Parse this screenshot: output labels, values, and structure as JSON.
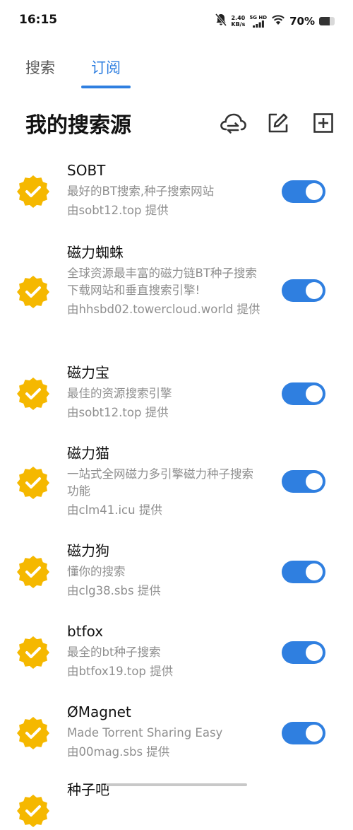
{
  "status_bar": {
    "time": "16:15",
    "net_speed_value": "2.40",
    "net_speed_unit": "KB/s",
    "signal_label": "5G HD",
    "battery_percent": "70%",
    "battery_level": 0.7
  },
  "tabs": [
    {
      "label": "搜索",
      "selected": false
    },
    {
      "label": "订阅",
      "selected": true
    }
  ],
  "section": {
    "title": "我的搜索源"
  },
  "icons": {
    "cloud_sync": "cloud-sync-icon",
    "edit": "edit-icon",
    "add": "add-icon",
    "badge": "verified-badge-icon"
  },
  "colors": {
    "accent": "#2f7fe0",
    "badge": "#f5b800",
    "secondary_text": "#8f8f8f"
  },
  "sources": [
    {
      "name": "SOBT",
      "desc": "最好的BT搜索,种子搜索网站",
      "provider": "由sobt12.top 提供",
      "enabled": true
    },
    {
      "name": "磁力蜘蛛",
      "desc": "全球资源最丰富的磁力链BT种子搜索下载网站和垂直搜索引擎!",
      "provider": "由hhsbd02.towercloud.world 提供",
      "enabled": true
    },
    {
      "name": "磁力宝",
      "desc": "最佳的资源搜索引擎",
      "provider": "由sobt12.top 提供",
      "enabled": true
    },
    {
      "name": "磁力猫",
      "desc": "一站式全网磁力多引擎磁力种子搜索功能",
      "provider": "由clm41.icu 提供",
      "enabled": true
    },
    {
      "name": "磁力狗",
      "desc": "懂你的搜索",
      "provider": "由clg38.sbs 提供",
      "enabled": true
    },
    {
      "name": "btfox",
      "desc": "最全的bt种子搜索",
      "provider": "由btfox19.top 提供",
      "enabled": true
    },
    {
      "name": "ØMagnet",
      "desc": "Made Torrent Sharing  Easy",
      "provider": "由00mag.sbs 提供",
      "enabled": true
    },
    {
      "name": "种子吧",
      "desc": "",
      "provider": "",
      "enabled": true
    }
  ]
}
